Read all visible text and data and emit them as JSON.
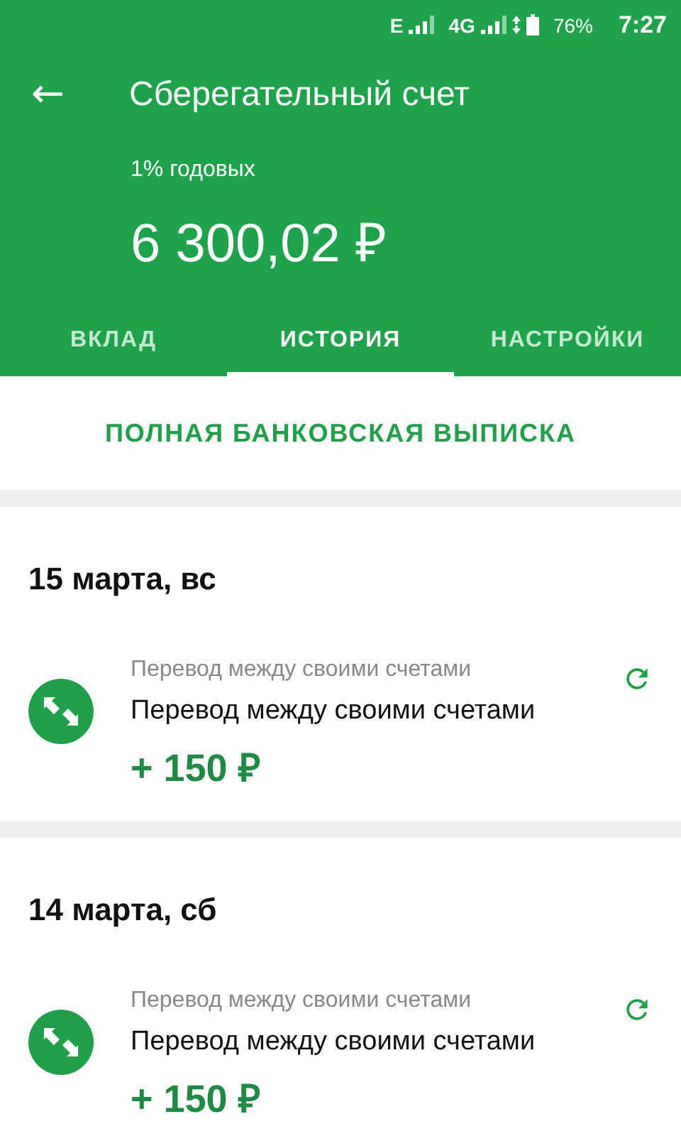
{
  "status_bar": {
    "network_1": "E",
    "network_2": "4G",
    "battery": "76%",
    "time": "7:27"
  },
  "header": {
    "back": "←",
    "title": "Сберегательный счет",
    "rate": "1% годовых",
    "balance": "6 300,02 ₽"
  },
  "tabs": [
    {
      "label": "ВКЛАД",
      "selected": false
    },
    {
      "label": "ИСТОРИЯ",
      "selected": true
    },
    {
      "label": "НАСТРОЙКИ",
      "selected": false
    }
  ],
  "statement_button": "ПОЛНАЯ БАНКОВСКАЯ ВЫПИСКА",
  "days": [
    {
      "date": "15 марта, вс",
      "transactions": [
        {
          "category": "Перевод между своими счетами",
          "title": "Перевод между своими счетами",
          "amount": "+ 150 ₽"
        }
      ]
    },
    {
      "date": "14 марта, сб",
      "transactions": [
        {
          "category": "Перевод между своими счетами",
          "title": "Перевод между своими счетами",
          "amount": "+ 150 ₽"
        }
      ]
    }
  ]
}
